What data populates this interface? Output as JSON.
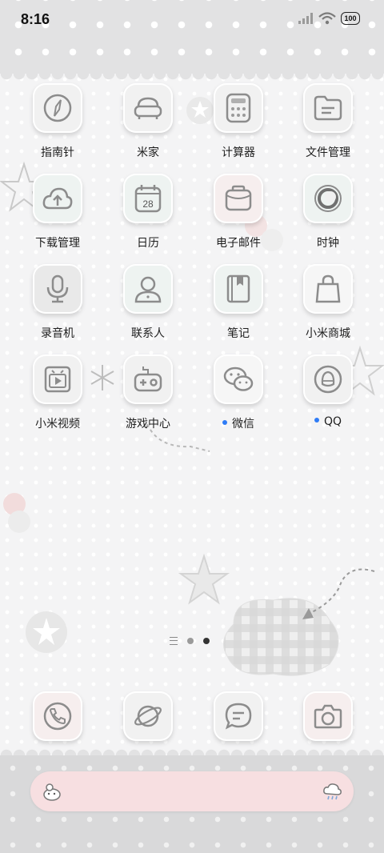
{
  "status_bar": {
    "time": "8:16",
    "battery": "100",
    "icons": [
      "signal-icon",
      "wifi-icon",
      "battery-icon"
    ]
  },
  "apps": [
    {
      "name": "compass",
      "label": "指南针",
      "icon": "compass-icon",
      "notify": false
    },
    {
      "name": "mijia",
      "label": "米家",
      "icon": "sofa-icon",
      "notify": false
    },
    {
      "name": "calculator",
      "label": "计算器",
      "icon": "calculator-icon",
      "notify": false
    },
    {
      "name": "file-manager",
      "label": "文件管理",
      "icon": "folder-icon",
      "notify": false
    },
    {
      "name": "download-manager",
      "label": "下载管理",
      "icon": "cloud-upload-icon",
      "notify": false
    },
    {
      "name": "calendar",
      "label": "日历",
      "icon": "calendar-icon",
      "day": "28",
      "notify": false
    },
    {
      "name": "email",
      "label": "电子邮件",
      "icon": "mail-icon",
      "notify": false
    },
    {
      "name": "clock",
      "label": "时钟",
      "icon": "clock-icon",
      "notify": false
    },
    {
      "name": "recorder",
      "label": "录音机",
      "icon": "microphone-icon",
      "notify": false
    },
    {
      "name": "contacts",
      "label": "联系人",
      "icon": "person-icon",
      "notify": false
    },
    {
      "name": "notes",
      "label": "笔记",
      "icon": "notebook-icon",
      "notify": false
    },
    {
      "name": "mi-store",
      "label": "小米商城",
      "icon": "shopping-bag-icon",
      "notify": false
    },
    {
      "name": "mi-video",
      "label": "小米视频",
      "icon": "video-icon",
      "notify": false
    },
    {
      "name": "game-center",
      "label": "游戏中心",
      "icon": "gamepad-icon",
      "notify": false
    },
    {
      "name": "wechat",
      "label": "微信",
      "icon": "wechat-icon",
      "notify": true
    },
    {
      "name": "qq",
      "label": "QQ",
      "icon": "penguin-icon",
      "notify": true
    }
  ],
  "page_indicator": {
    "pages": 2,
    "current": 2
  },
  "dock": [
    {
      "name": "phone",
      "icon": "phone-icon"
    },
    {
      "name": "browser",
      "icon": "planet-icon"
    },
    {
      "name": "messages",
      "icon": "chat-bubble-icon"
    },
    {
      "name": "camera",
      "icon": "camera-icon"
    }
  ],
  "search_bar": {
    "left_icon": "xiaoai-assistant-icon",
    "right_icon": "weather-cloud-icon"
  },
  "colors": {
    "notify_dot": "#2f7cf6",
    "search_bar": "#f7dfe1",
    "icon_stroke": "#8c8c8c"
  }
}
